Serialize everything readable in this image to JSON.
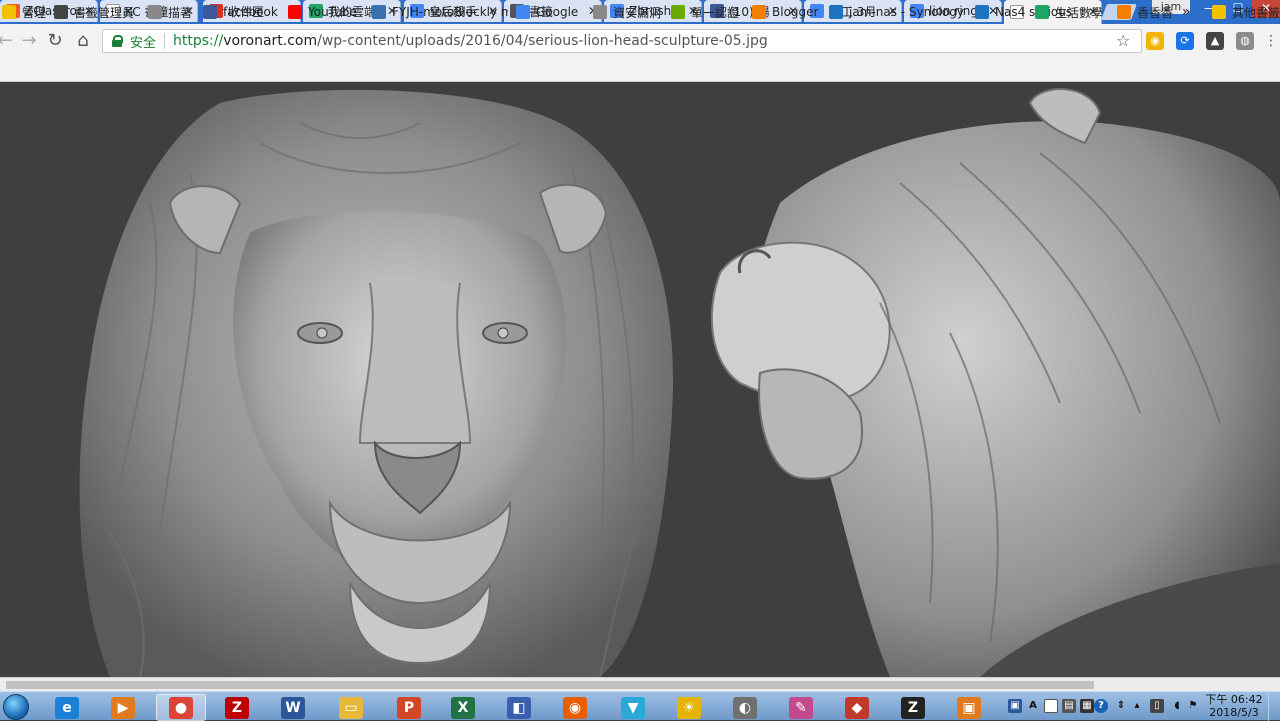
{
  "tabs": [
    {
      "title": "ZClassroom",
      "icon": "zbrush-icon",
      "color": "#f05a1a"
    },
    {
      "title": "KC 書僮",
      "icon": "page-icon",
      "color": "#ffffff"
    },
    {
      "title": "收件匣",
      "icon": "gmail-icon",
      "color": "#d93025"
    },
    {
      "title": "我的雲端",
      "icon": "drive-icon",
      "color": "#1fa463"
    },
    {
      "title": "皇后殺手",
      "icon": "google-icon",
      "color": "#4285f4"
    },
    {
      "title": "書籤",
      "icon": "star-icon",
      "color": "#555555"
    },
    {
      "title": "Zbrush",
      "icon": "google-icon",
      "color": "#4285f4"
    },
    {
      "title": "(10) 楊",
      "icon": "facebook-icon",
      "color": "#3b5998"
    },
    {
      "title": "勞工 3月",
      "icon": "google-icon",
      "color": "#4285f4"
    },
    {
      "title": "lion ring",
      "icon": "google-icon",
      "color": "#4285f4"
    },
    {
      "title": "serious",
      "icon": "page-icon",
      "color": "#ffffff"
    }
  ],
  "profile": "jam",
  "window_controls": {
    "minimize": "—",
    "maximize": "☐",
    "close": "✕"
  },
  "address_bar": {
    "secure_label": "安全",
    "url_scheme": "https://",
    "url_host": "voronart.com",
    "url_path": "/wp-content/uploads/2016/04/serious-lion-head-sculpture-05.jpg"
  },
  "bookmarks": [
    {
      "label": "管理",
      "icon": "folder-icon",
      "color": "#f2c200"
    },
    {
      "label": "書籤管理員",
      "icon": "star-icon",
      "color": "#444444"
    },
    {
      "label": "描著",
      "icon": "page-icon",
      "color": "#888888"
    },
    {
      "label": "facebook",
      "icon": "facebook-icon",
      "color": "#3b5998"
    },
    {
      "label": "YouTube",
      "icon": "youtube-icon",
      "color": "#ff0000"
    },
    {
      "label": "FYJH-motoBlockly m",
      "icon": "puzzle-icon",
      "color": "#3a6fb0"
    },
    {
      "label": "Google",
      "icon": "google-icon",
      "color": "#4285f4"
    },
    {
      "label": "資安漏洞",
      "icon": "page-icon",
      "color": "#888888"
    },
    {
      "label": "單一認證",
      "icon": "circle-icon",
      "color": "#6aaa00"
    },
    {
      "label": "Blogger",
      "icon": "blogger-icon",
      "color": "#f57d00"
    },
    {
      "label": "jam-nas - Synology",
      "icon": "dsm-icon",
      "color": "#1e73be"
    },
    {
      "label": "Nas4",
      "icon": "dsm-icon",
      "color": "#1e73be"
    },
    {
      "label": "生活數學",
      "icon": "drive-icon",
      "color": "#1fa463"
    },
    {
      "label": "香香香",
      "icon": "blogger-icon",
      "color": "#f57d00"
    }
  ],
  "bookmarks_overflow": "»",
  "other_bookmarks": "其他書籤",
  "taskbar_apps": [
    {
      "name": "ie-icon",
      "glyph": "e",
      "color": "#1b80d8"
    },
    {
      "name": "media-player-icon",
      "glyph": "▶",
      "color": "#e07a1f"
    },
    {
      "name": "chrome-icon",
      "glyph": "●",
      "color": "#db4437"
    },
    {
      "name": "filezilla-icon",
      "glyph": "Z",
      "color": "#bf0000"
    },
    {
      "name": "word-icon",
      "glyph": "W",
      "color": "#2b579a"
    },
    {
      "name": "folder-icon",
      "glyph": "▭",
      "color": "#e8b83a"
    },
    {
      "name": "powerpoint-icon",
      "glyph": "P",
      "color": "#d24726"
    },
    {
      "name": "excel-icon",
      "glyph": "X",
      "color": "#217346"
    },
    {
      "name": "network-icon",
      "glyph": "◧",
      "color": "#3a5fb0"
    },
    {
      "name": "firefox-icon",
      "glyph": "◉",
      "color": "#e66000"
    },
    {
      "name": "vector-icon",
      "glyph": "▼",
      "color": "#2aa8d8"
    },
    {
      "name": "sun-icon",
      "glyph": "☀",
      "color": "#e5b400"
    },
    {
      "name": "sphere-icon",
      "glyph": "◐",
      "color": "#707070"
    },
    {
      "name": "paint-icon",
      "glyph": "✎",
      "color": "#c44a8f"
    },
    {
      "name": "gem-icon",
      "glyph": "◆",
      "color": "#c0392b"
    },
    {
      "name": "zbrush-icon",
      "glyph": "Z",
      "color": "#222222"
    },
    {
      "name": "app-icon",
      "glyph": "▣",
      "color": "#e07a1f"
    }
  ],
  "tray": {
    "ime_label": "A",
    "help_label": "?",
    "clock_period": "下午",
    "clock_time": "06:42",
    "clock_date": "2018/5/3"
  }
}
